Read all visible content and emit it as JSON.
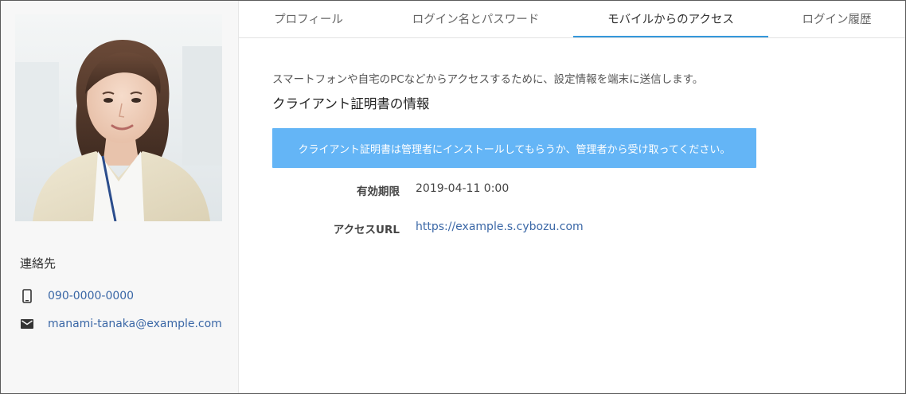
{
  "tabs": [
    {
      "label": "プロフィール",
      "active": false
    },
    {
      "label": "ログイン名とパスワード",
      "active": false
    },
    {
      "label": "モバイルからのアクセス",
      "active": true
    },
    {
      "label": "ログイン履歴",
      "active": false
    }
  ],
  "sidebar": {
    "contact_title": "連絡先",
    "phone": "090-0000-0000",
    "email": "manami-tanaka@example.com",
    "icons": {
      "phone": "smartphone-icon",
      "email": "mail-icon"
    }
  },
  "main": {
    "description": "スマートフォンや自宅のPCなどからアクセスするために、設定情報を端末に送信します。",
    "section_title": "クライアント証明書の情報",
    "notice": "クライアント証明書は管理者にインストールしてもらうか、管理者から受け取ってください。",
    "rows": [
      {
        "label": "有効期限",
        "value": "2019-04-11 0:00"
      },
      {
        "label": "アクセスURL",
        "value": "https://example.s.cybozu.com"
      }
    ]
  },
  "colors": {
    "accent": "#3498db",
    "notice_bg": "#64b5f6",
    "link": "#3a67a6",
    "sidebar_bg": "#f7f7f7"
  }
}
